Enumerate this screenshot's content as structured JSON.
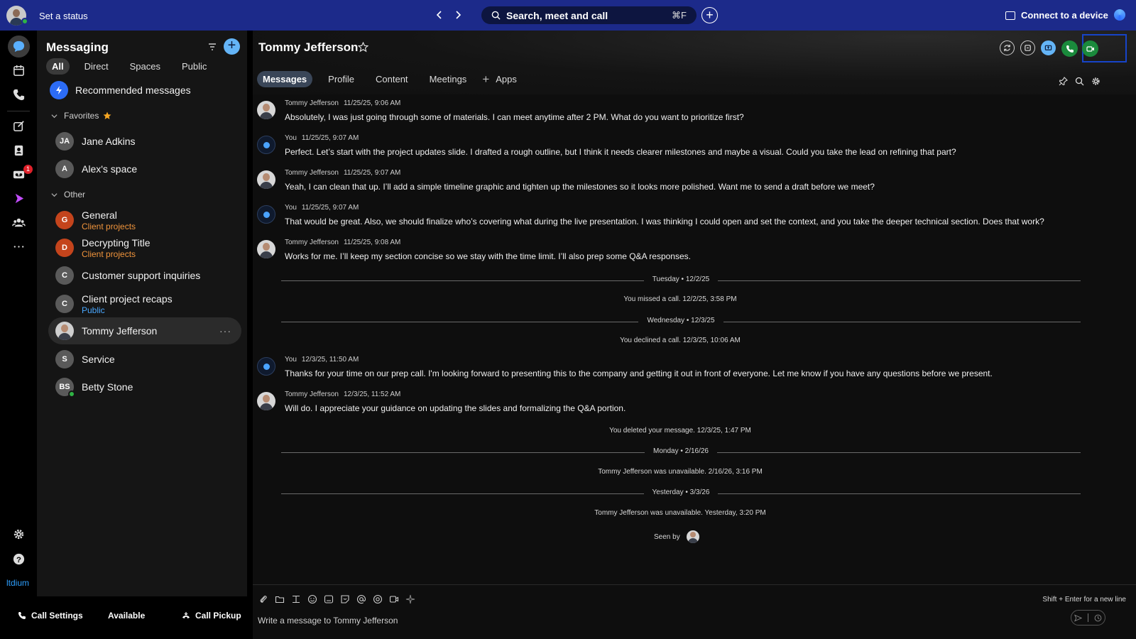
{
  "topbar": {
    "status_label": "Set a status",
    "search_text": "Search, meet and call",
    "search_shortcut": "⌘F",
    "connect_device": "Connect to a device"
  },
  "rail": {
    "voicemail_badge": "1",
    "brand": "ltdium"
  },
  "sidebar": {
    "title": "Messaging",
    "tabs": [
      "All",
      "Direct",
      "Spaces",
      "Public"
    ],
    "active_tab": "All",
    "recommended": "Recommended messages",
    "favorites_label": "Favorites",
    "other_label": "Other",
    "favorites": [
      {
        "initials": "JA",
        "name": "Jane Adkins",
        "color": "#5a5a5a"
      },
      {
        "initials": "A",
        "name": "Alex's space",
        "color": "#5a5a5a"
      }
    ],
    "others": [
      {
        "initials": "G",
        "name": "General",
        "sub": "Client projects",
        "sub_color": "#f0943c",
        "color": "#c4441c"
      },
      {
        "initials": "D",
        "name": "Decrypting Title",
        "sub": "Client projects",
        "sub_color": "#f0943c",
        "color": "#c4441c"
      },
      {
        "initials": "C",
        "name": "Customer support inquiries",
        "color": "#5a5a5a"
      },
      {
        "initials": "C",
        "name": "Client project recaps",
        "sub": "Public",
        "sub_color": "#4aa8ff",
        "color": "#5a5a5a"
      },
      {
        "name": "Tommy Jefferson",
        "selected": true,
        "more": "···"
      },
      {
        "initials": "S",
        "name": "Service",
        "color": "#5a5a5a"
      },
      {
        "initials": "BS",
        "name": "Betty Stone",
        "color": "#5a5a5a",
        "presence": "available"
      }
    ]
  },
  "bottom": {
    "call_settings": "Call Settings",
    "availability": "Available",
    "call_pickup": "Call Pickup"
  },
  "main": {
    "contact_name": "Tommy Jefferson",
    "tabs": [
      "Messages",
      "Profile",
      "Content",
      "Meetings"
    ],
    "active_tab": "Messages",
    "apps_label": "Apps",
    "messages": [
      {
        "sender": "Tommy Jefferson",
        "time": "11/25/25, 9:06 AM",
        "you": false,
        "text": "Absolutely, I was just going through some of materials. I can meet anytime after 2 PM. What do you want to prioritize first?"
      },
      {
        "sender": "You",
        "time": "11/25/25, 9:07 AM",
        "you": true,
        "text": "Perfect. Let’s start with the project updates slide. I drafted a rough outline, but I think it needs clearer milestones and maybe a visual. Could you take the lead on refining that part?"
      },
      {
        "sender": "Tommy Jefferson",
        "time": "11/25/25, 9:07 AM",
        "you": false,
        "text": "Yeah, I can clean that up. I’ll add a simple timeline graphic and tighten up the milestones so it looks more polished. Want me to send a draft before we meet?"
      },
      {
        "sender": "You",
        "time": "11/25/25, 9:07 AM",
        "you": true,
        "text": "That would be great. Also, we should finalize who’s covering what during the live presentation. I was thinking I could open and set the context, and you take the deeper technical section. Does that work?"
      },
      {
        "sender": "Tommy Jefferson",
        "time": "11/25/25, 9:08 AM",
        "you": false,
        "text": "Works for me. I’ll keep my section concise so we stay with the time limit. I’ll also prep some Q&A responses."
      },
      {
        "sender": "You",
        "time": "12/3/25, 11:50 AM",
        "you": true,
        "text": "Thanks for your time on our prep call. I'm looking forward to presenting this to the company and getting it out in front of everyone. Let me know if you have any questions before we present."
      },
      {
        "sender": "Tommy Jefferson",
        "time": "12/3/25, 11:52 AM",
        "you": false,
        "text": "Will do. I appreciate your guidance on updating the slides and formalizing the Q&A portion."
      }
    ],
    "dividers": [
      "Tuesday • 12/2/25",
      "Wednesday • 12/3/25",
      "Monday • 2/16/26",
      "Yesterday • 3/3/26"
    ],
    "events": [
      "You missed a call. 12/2/25, 3:58 PM",
      "You declined a call. 12/3/25, 10:06 AM",
      "You deleted your message. 12/3/25, 1:47 PM",
      "Tommy Jefferson was unavailable. 2/16/26, 3:16 PM",
      "Tommy Jefferson was unavailable. Yesterday, 3:20 PM"
    ],
    "seen_by": "Seen by"
  },
  "composer": {
    "hint": "Shift + Enter for a new line",
    "placeholder": "Write a message to Tommy Jefferson"
  },
  "colors": {
    "topbar": "#1c2a8a",
    "call_green": "#1a8a3c",
    "accent_blue": "#64b4f6",
    "highlight": "#1744c9"
  }
}
